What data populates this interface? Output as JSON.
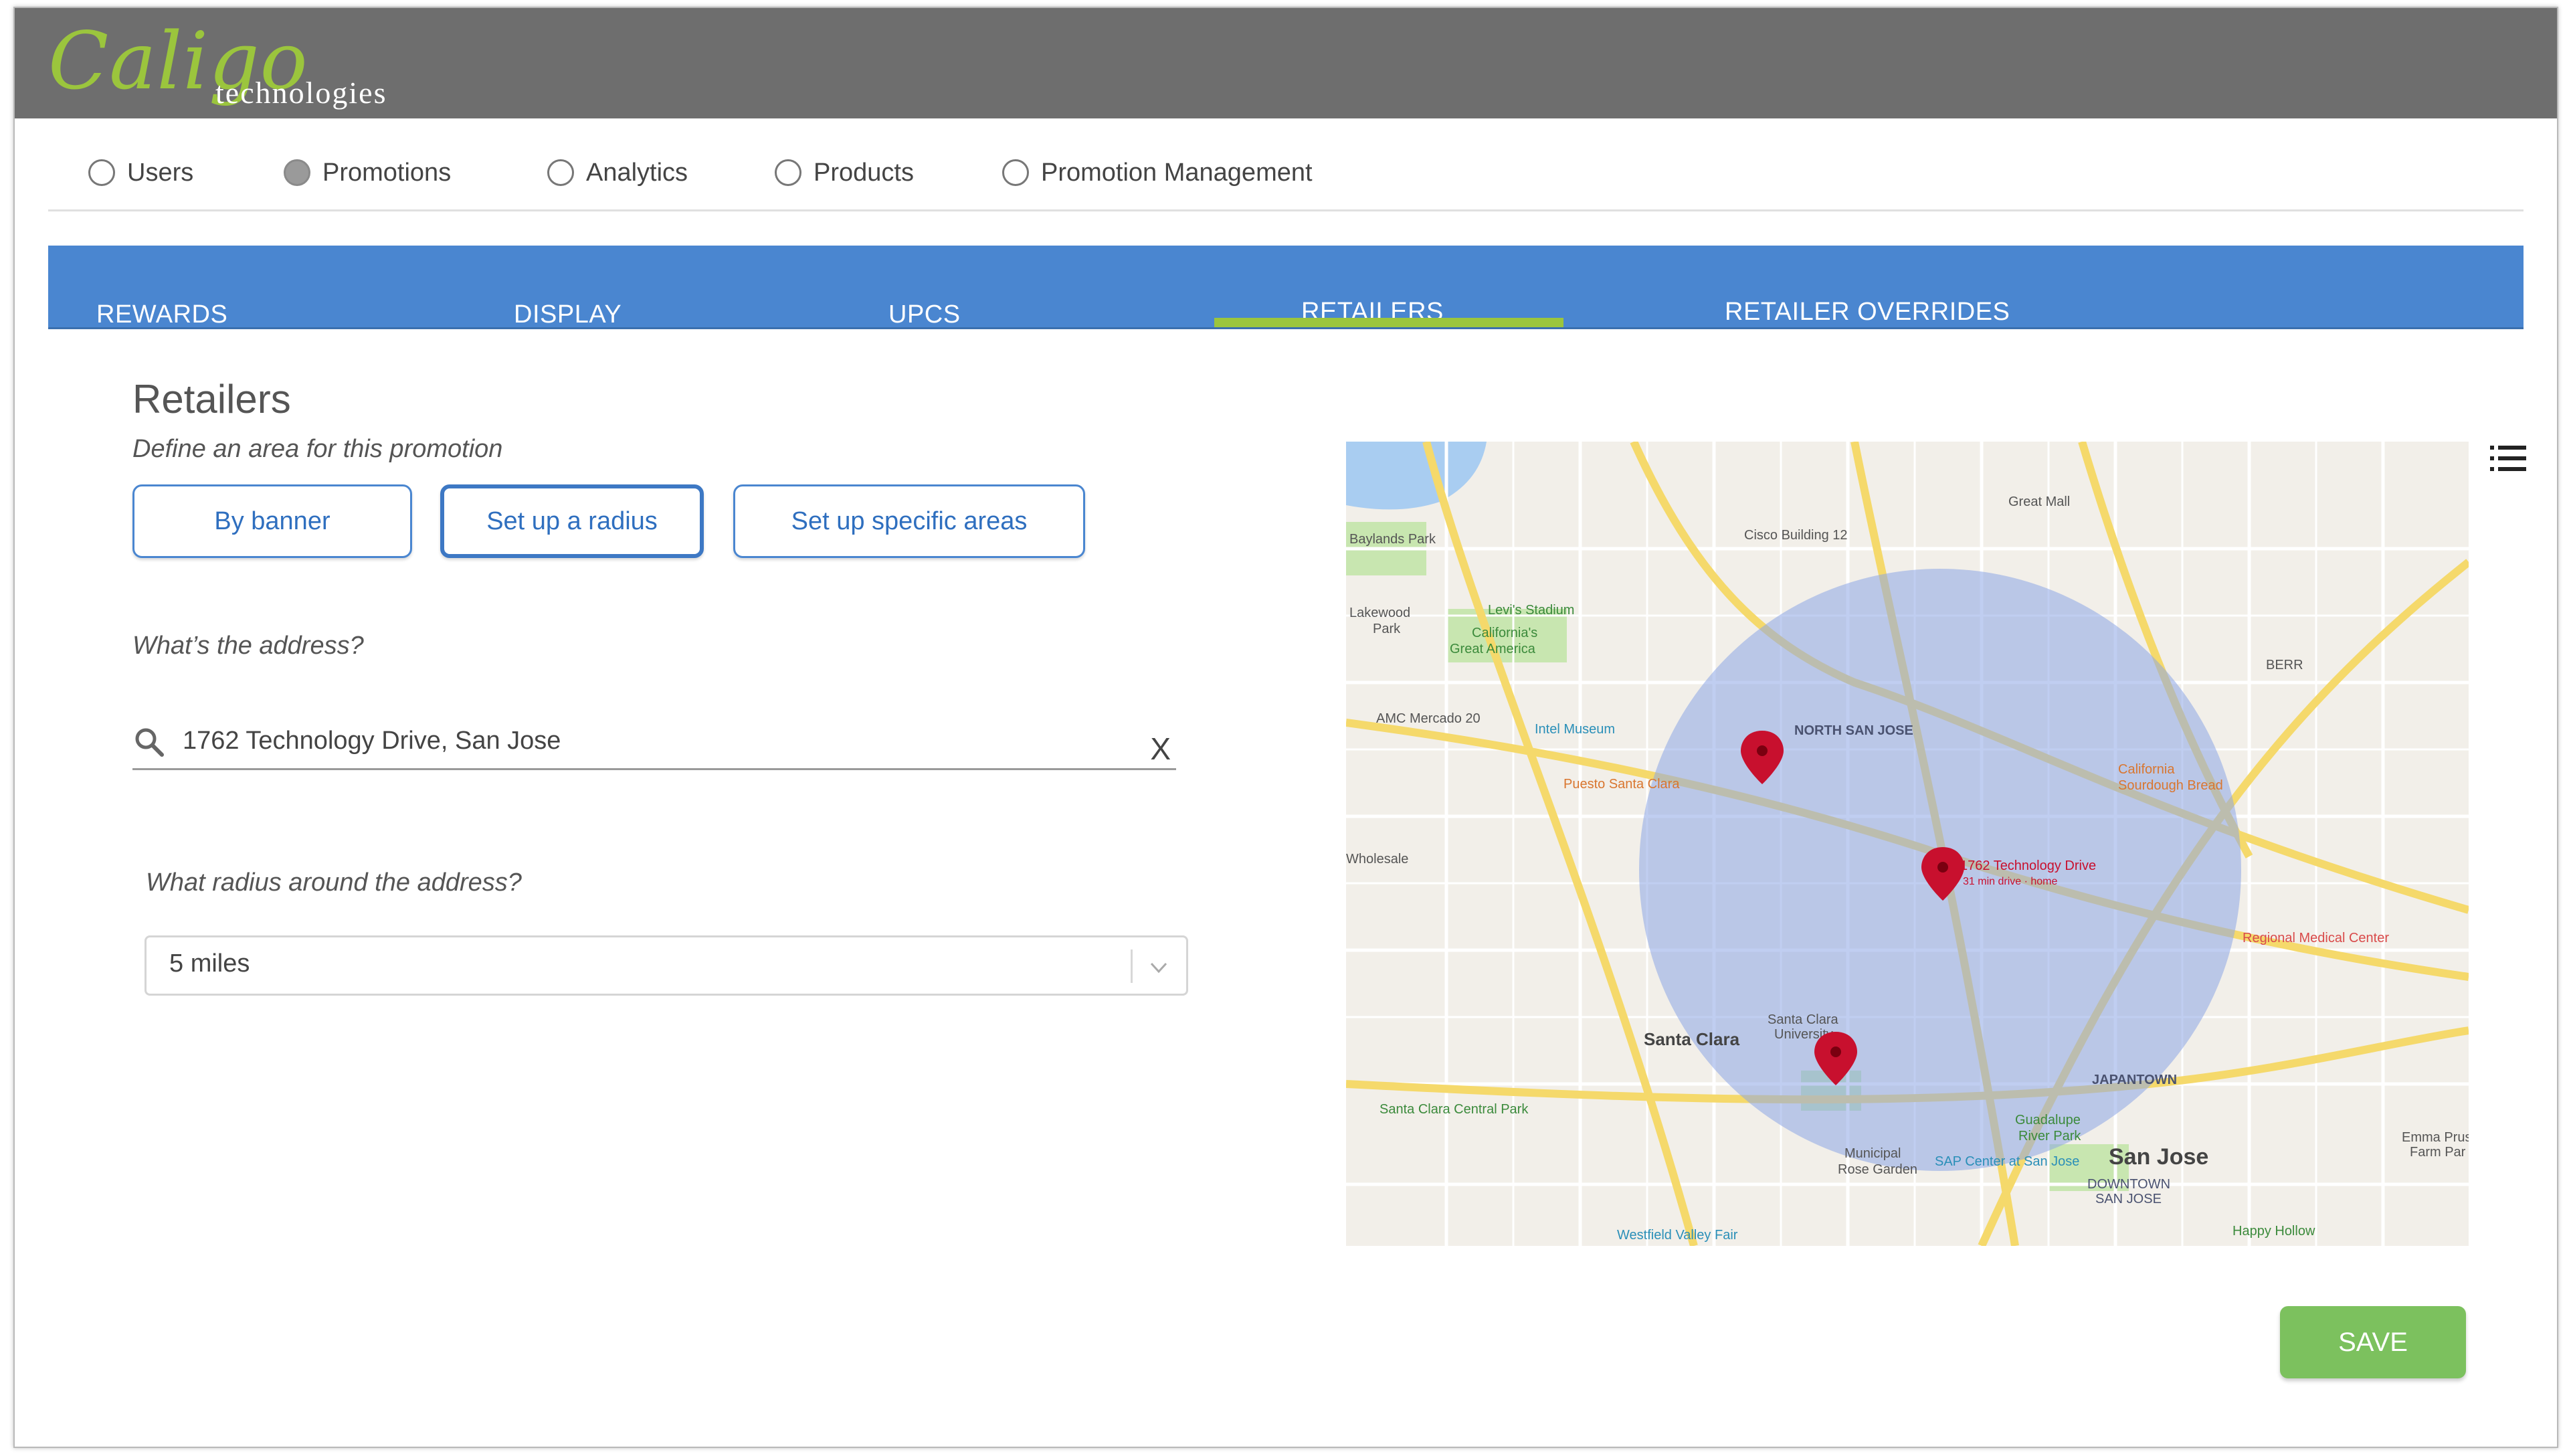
{
  "brand": {
    "name": "Caligo",
    "tagline": "technologies",
    "accent": "#9bc53d"
  },
  "topnav": {
    "items": [
      {
        "label": "Users",
        "selected": false
      },
      {
        "label": "Promotions",
        "selected": true
      },
      {
        "label": "Analytics",
        "selected": false
      },
      {
        "label": "Products",
        "selected": false
      },
      {
        "label": "Promotion Management",
        "selected": false
      }
    ]
  },
  "tabs": {
    "active": "RETAILERS",
    "items": [
      {
        "label": "REWARDS"
      },
      {
        "label": "DISPLAY"
      },
      {
        "label": "UPCS"
      },
      {
        "label": "RETAILERS"
      },
      {
        "label": "RETAILER OVERRIDES"
      }
    ]
  },
  "section": {
    "title": "Retailers",
    "subtitle": "Define an area for this promotion"
  },
  "area_options": {
    "active": "Set up a radius",
    "items": [
      {
        "label": "By banner"
      },
      {
        "label": "Set up a radius"
      },
      {
        "label": "Set up specific areas"
      }
    ]
  },
  "address": {
    "question": "What’s the address?",
    "value": "1762 Technology Drive, San Jose",
    "clear_label": "X"
  },
  "radius": {
    "question": "What radius around the address?",
    "selected": "5 miles"
  },
  "map": {
    "center_label": "1762 Technology Drive",
    "center_sublabel": "31 min drive · home",
    "labels": {
      "great_mall": "Great Mall",
      "cisco": "Cisco Building 12",
      "baylands": "Baylands Park",
      "levis": "Levi's Stadium",
      "californias": "California's",
      "great_america": "Great America",
      "lakewood": "Lakewood",
      "park": "Park",
      "amc": "AMC Mercado 20",
      "intel": "Intel Museum",
      "north_san_jose": "NORTH SAN JOSE",
      "puesto": "Puesto Santa Clara",
      "california_sourdough": "California",
      "sourdough_bread": "Sourdough Bread",
      "wholesale": "Wholesale",
      "regional": "Regional Medical Center",
      "santa_clara": "Santa Clara",
      "scu": "Santa Clara",
      "university": "University",
      "japantown": "JAPANTOWN",
      "guadalupe": "Guadalupe",
      "river_park": "River Park",
      "central_park": "Santa Clara Central Park",
      "municipal": "Municipal",
      "rose_garden": "Rose Garden",
      "sap": "SAP Center at San Jose",
      "san_jose": "San Jose",
      "downtown": "DOWNTOWN",
      "downtown_sj": "SAN JOSE",
      "westfield": "Westfield Valley Fair",
      "happy_hollow": "Happy Hollow",
      "emma": "Emma Prus",
      "farm": "Farm Par",
      "berr": "BERR"
    },
    "colors": {
      "radius_fill": "#8da6e6",
      "pin": "#c8102e",
      "water": "#a9cdf1",
      "park": "#c8e6b0",
      "road": "#f5d96b"
    }
  },
  "save_label": "SAVE"
}
